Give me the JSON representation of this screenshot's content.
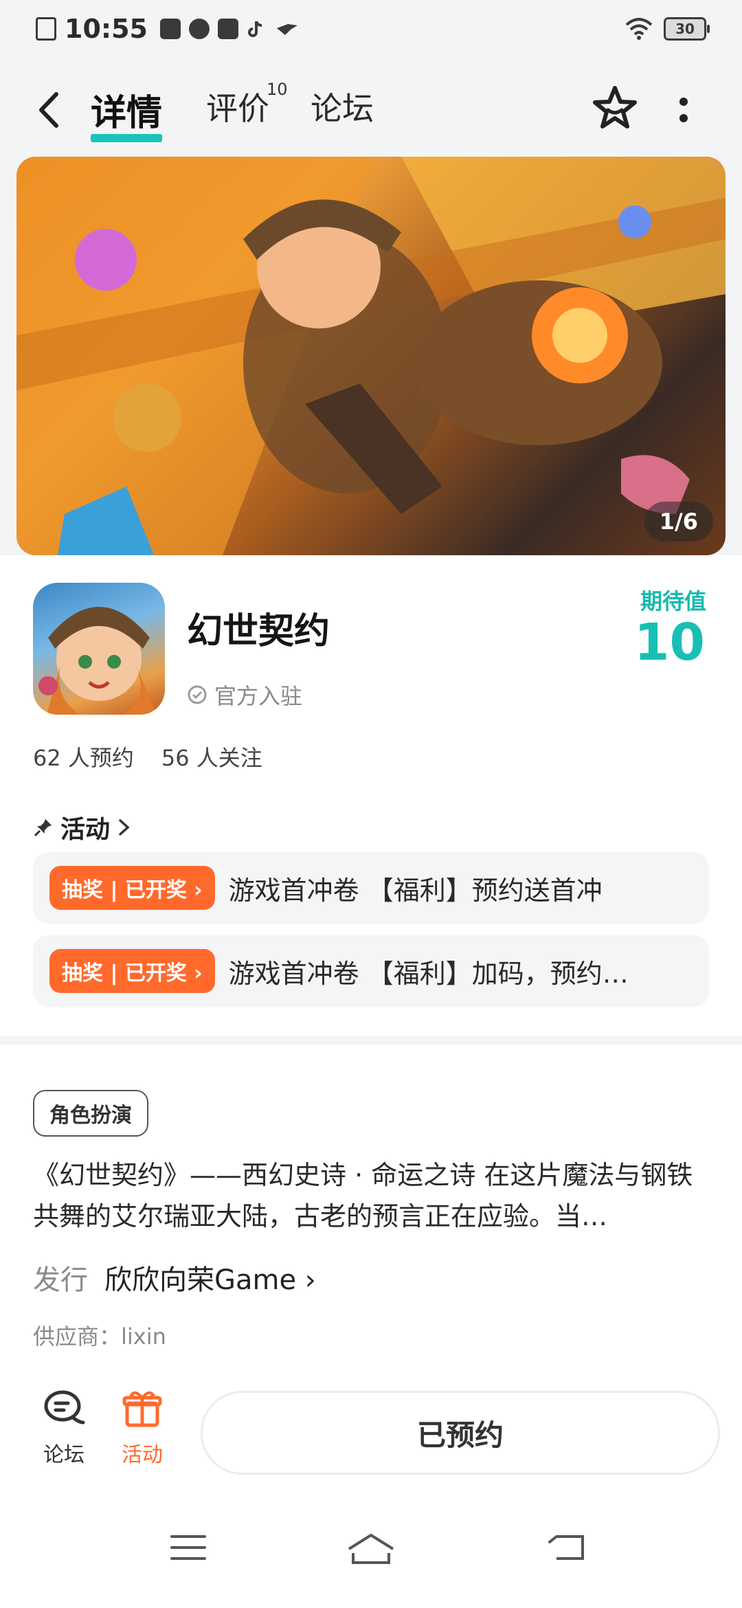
{
  "status": {
    "time": "10:55",
    "battery": "30"
  },
  "nav": {
    "tabs": [
      {
        "label": "详情",
        "active": true
      },
      {
        "label": "评价",
        "badge": "10"
      },
      {
        "label": "论坛"
      }
    ]
  },
  "banner": {
    "counter": "1/6"
  },
  "app": {
    "name": "幻世契约",
    "official": "官方入驻",
    "expect_label": "期待值",
    "expect_value": "10",
    "reservations": "62 人预约",
    "followers": "56 人关注"
  },
  "activities": {
    "title": "活动",
    "items": [
      {
        "tag": "抽奖 | 已开奖 ›",
        "text": "游戏首冲卷 【福利】预约送首冲"
      },
      {
        "tag": "抽奖 | 已开奖 ›",
        "text": "游戏首冲卷 【福利】加码，预约…"
      }
    ]
  },
  "details": {
    "genre": "角色扮演",
    "description": "《幻世契约》——西幻史诗 · 命运之诗 在这片魔法与钢铁共舞的艾尔瑞亚大陆，古老的预言正在应验。当…",
    "publisher_label": "发行",
    "publisher": "欣欣向荣Game ›",
    "supplier": "供应商：lixin"
  },
  "bottom_bar": {
    "forum": "论坛",
    "activity": "活动",
    "reserve": "已预约"
  },
  "colors": {
    "accent": "#18c4b8",
    "promo": "#ff6a2c",
    "activity": "#ff6a2c"
  }
}
